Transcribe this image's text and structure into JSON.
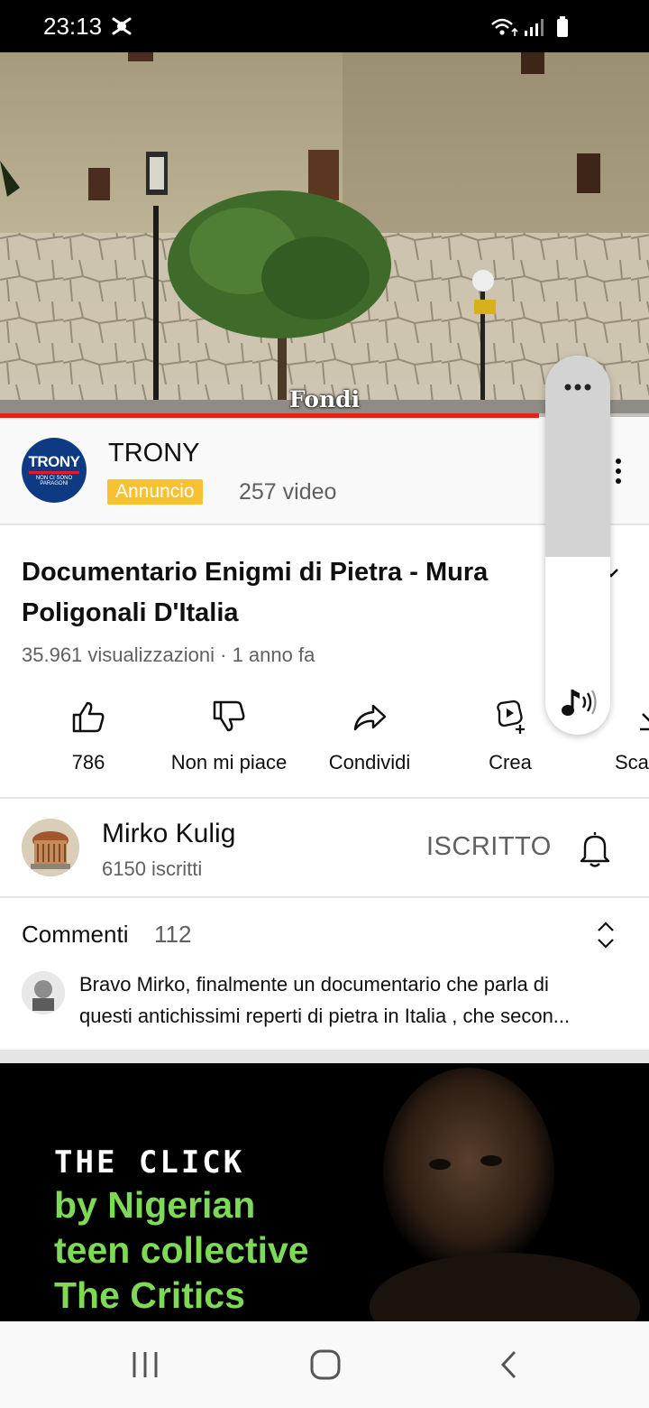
{
  "status_bar": {
    "time": "23:13"
  },
  "video": {
    "caption": "Fondi",
    "progress_fraction": 0.83
  },
  "ad": {
    "name": "TRONY",
    "logo_text": "TRONY",
    "logo_tagline": "NON CI SONO PARAGONI",
    "badge": "Annuncio",
    "video_count": "257 video",
    "badge_color": "#f7c133"
  },
  "video_info": {
    "title_line1": "Documentario Enigmi di Pietra - Mura",
    "title_line2": "Poligonali D'Italia",
    "meta": "35.961 visualizzazioni · 1 anno fa"
  },
  "actions": [
    {
      "label": "786",
      "icon": "thumb-up-icon"
    },
    {
      "label": "Non mi piace",
      "icon": "thumb-down-icon"
    },
    {
      "label": "Condividi",
      "icon": "share-icon"
    },
    {
      "label": "Crea",
      "icon": "create-icon"
    },
    {
      "label": "Sca",
      "icon": "download-icon"
    }
  ],
  "channel": {
    "name": "Mirko Kulig",
    "subscribers": "6150 iscritti",
    "subscribe_label": "ISCRITTO"
  },
  "comments": {
    "title": "Commenti",
    "count": "112",
    "first_line1": "Bravo Mirko, finalmente un documentario  che parla di",
    "first_line2": "questi antichissimi reperti di pietra in Italia , che secon..."
  },
  "banner": {
    "headline": "THE CLICK",
    "line1": "by Nigerian",
    "line2": "teen collective",
    "line3": "The Critics",
    "text_color": "#7ed957"
  },
  "volume": {
    "level_fraction": 0.47
  },
  "colors": {
    "accent": "#e62117",
    "secondary_text": "#606060"
  }
}
